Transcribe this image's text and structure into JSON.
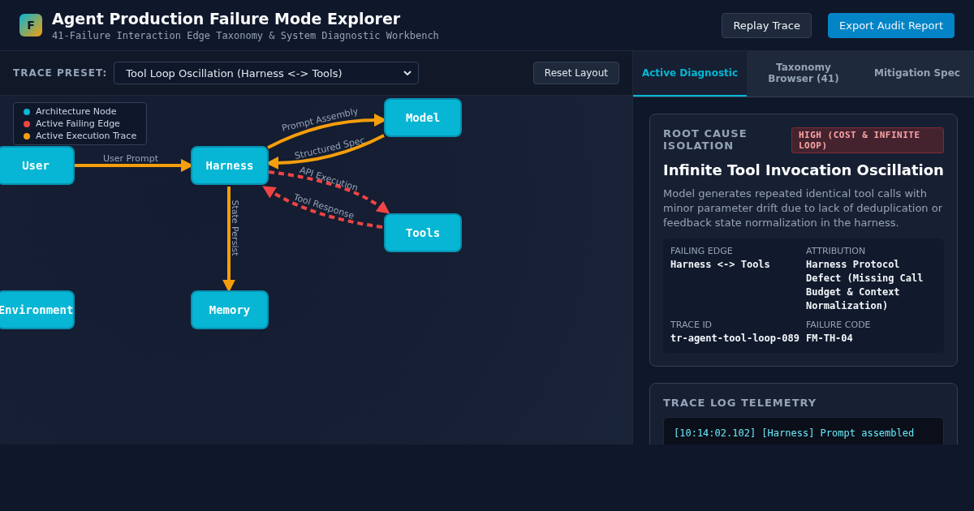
{
  "header": {
    "logo": "F",
    "title": "Agent Production Failure Mode Explorer",
    "subtitle": "41-Failure Interaction Edge Taxonomy & System Diagnostic Workbench",
    "buttons": [
      {
        "label": "Replay Trace",
        "kind": "secondary"
      },
      {
        "label": "Export Audit Report",
        "kind": "primary"
      }
    ]
  },
  "toolbar": {
    "label": "TRACE PRESET:",
    "preset": "Tool Loop Oscillation (Harness <-> Tools)",
    "reset": "Reset Layout"
  },
  "legend": [
    {
      "label": "Architecture Node",
      "color": "#06b6d4"
    },
    {
      "label": "Active Failing Edge",
      "color": "#ef4444"
    },
    {
      "label": "Active Execution Trace",
      "color": "#f59e0b"
    }
  ],
  "nodes": [
    "User",
    "Harness",
    "Model",
    "Tools",
    "Environment",
    "Memory"
  ],
  "edges": [
    {
      "label": "User Prompt",
      "kind": "trace"
    },
    {
      "label": "Prompt Assembly",
      "kind": "trace"
    },
    {
      "label": "Structured Spec",
      "kind": "trace"
    },
    {
      "label": "API Execution",
      "kind": "failing"
    },
    {
      "label": "Tool Response",
      "kind": "failing"
    },
    {
      "label": "State Persist",
      "kind": "trace"
    }
  ],
  "tabs": [
    {
      "label": "Active Diagnostic",
      "selected": true
    },
    {
      "label": "Taxonomy Browser (41)",
      "selected": false
    },
    {
      "label": "Mitigation Spec",
      "selected": false
    }
  ],
  "diagnostic": {
    "heading": "ROOT CAUSE ISOLATION",
    "severity": "HIGH (COST & INFINITE LOOP)",
    "title": "Infinite Tool Invocation Oscillation",
    "description": "Model generates repeated identical tool calls with minor parameter drift due to lack of deduplication or feedback state normalization in the harness.",
    "fields": [
      {
        "label": "FAILING EDGE",
        "value": "Harness <-> Tools"
      },
      {
        "label": "ATTRIBUTION",
        "value": "Harness Protocol Defect (Missing Call Budget & Context Normalization)"
      },
      {
        "label": "TRACE ID",
        "value": "tr-agent-tool-loop-089"
      },
      {
        "label": "FAILURE CODE",
        "value": "FM-TH-04"
      }
    ]
  },
  "telemetry": {
    "heading": "TRACE LOG TELEMETRY",
    "lines": [
      "[10:14:02.102] [Harness] Prompt assembled"
    ]
  }
}
